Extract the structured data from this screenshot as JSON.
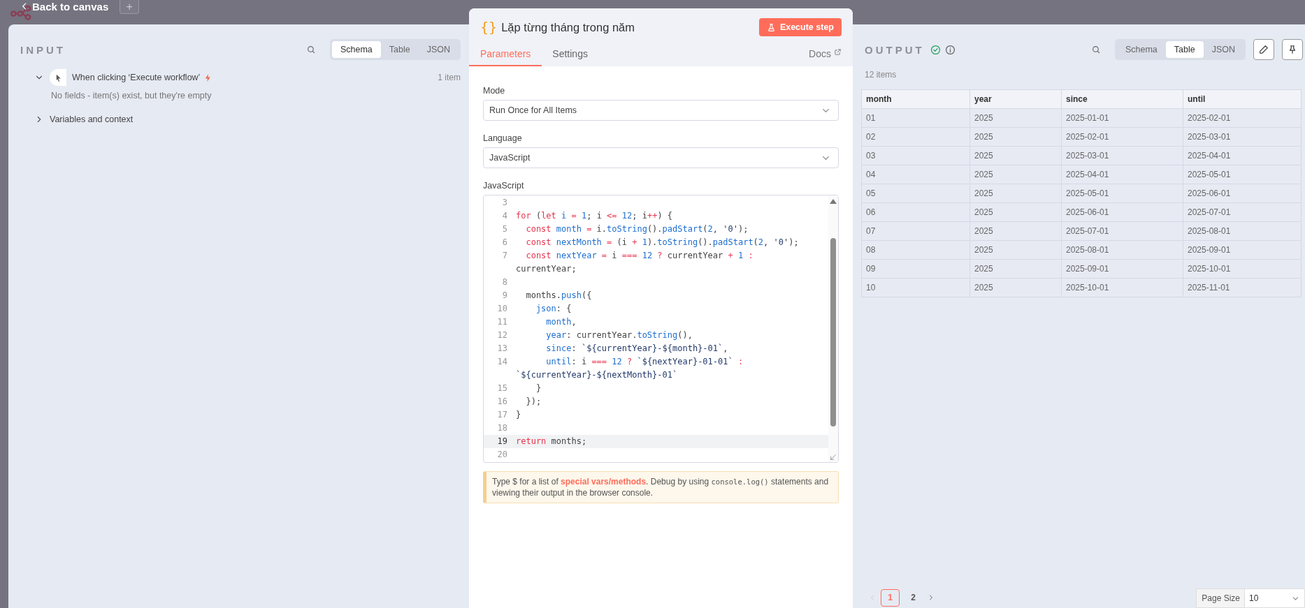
{
  "top_bar": {
    "back_label": "Back to canvas",
    "add_label": "+"
  },
  "input_panel": {
    "title": "INPUT",
    "view_tabs": [
      {
        "label": "Schema",
        "selected": true
      },
      {
        "label": "Table",
        "selected": false
      },
      {
        "label": "JSON",
        "selected": false
      }
    ],
    "tree": [
      {
        "label": "When clicking ‘Execute workflow’",
        "expanded": true,
        "kind": "trigger",
        "count": "1 item",
        "note": "No fields - item(s) exist, but they're empty"
      },
      {
        "label": "Variables and context",
        "expanded": false,
        "kind": "group"
      }
    ]
  },
  "node_panel": {
    "icon": "{}",
    "title": "Lặp từng tháng trong năm",
    "execute_button": "Execute step",
    "tabs": [
      {
        "label": "Parameters",
        "selected": true
      },
      {
        "label": "Settings",
        "selected": false
      }
    ],
    "docs_link": "Docs",
    "fields": [
      {
        "label": "Mode",
        "value": "Run Once for All Items"
      },
      {
        "label": "Language",
        "value": "JavaScript"
      }
    ],
    "code_label": "JavaScript",
    "code_lines": [
      {
        "number": "3",
        "active": false
      },
      {
        "number": "4",
        "active": false,
        "tokens": [
          {
            "kind": "kw",
            "text": "for"
          },
          {
            "kind": "p",
            "text": " ("
          },
          {
            "kind": "kw",
            "text": "let"
          },
          {
            "kind": "def",
            "text": " i"
          },
          {
            "kind": "op",
            "text": " ="
          },
          {
            "kind": "num",
            "text": " 1"
          },
          {
            "kind": "p",
            "text": "; i "
          },
          {
            "kind": "op",
            "text": "<="
          },
          {
            "kind": "num",
            "text": " 12"
          },
          {
            "kind": "p",
            "text": "; i"
          },
          {
            "kind": "op",
            "text": "++"
          },
          {
            "kind": "p",
            "text": ") {"
          }
        ]
      },
      {
        "number": "5",
        "active": false,
        "tokens": [
          {
            "kind": "kw",
            "text": "  const"
          },
          {
            "kind": "def",
            "text": " month"
          },
          {
            "kind": "op",
            "text": " ="
          },
          {
            "kind": "p",
            "text": " i."
          },
          {
            "kind": "prop",
            "text": "toString"
          },
          {
            "kind": "p",
            "text": "()."
          },
          {
            "kind": "prop",
            "text": "padStart"
          },
          {
            "kind": "p",
            "text": "("
          },
          {
            "kind": "num",
            "text": "2"
          },
          {
            "kind": "p",
            "text": ", "
          },
          {
            "kind": "str",
            "text": "'0'"
          },
          {
            "kind": "p",
            "text": ");"
          }
        ]
      },
      {
        "number": "6",
        "active": false,
        "tokens": [
          {
            "kind": "kw",
            "text": "  const"
          },
          {
            "kind": "def",
            "text": " nextMonth"
          },
          {
            "kind": "op",
            "text": " ="
          },
          {
            "kind": "p",
            "text": " (i "
          },
          {
            "kind": "op",
            "text": "+"
          },
          {
            "kind": "num",
            "text": " 1"
          },
          {
            "kind": "p",
            "text": ")."
          },
          {
            "kind": "prop",
            "text": "toString"
          },
          {
            "kind": "p",
            "text": "()."
          },
          {
            "kind": "prop",
            "text": "padStart"
          },
          {
            "kind": "p",
            "text": "("
          },
          {
            "kind": "num",
            "text": "2"
          },
          {
            "kind": "p",
            "text": ", "
          },
          {
            "kind": "str",
            "text": "'0'"
          },
          {
            "kind": "p",
            "text": ");"
          }
        ]
      },
      {
        "number": "7",
        "active": false,
        "tokens": [
          {
            "kind": "kw",
            "text": "  const"
          },
          {
            "kind": "def",
            "text": " nextYear"
          },
          {
            "kind": "op",
            "text": " ="
          },
          {
            "kind": "p",
            "text": " i "
          },
          {
            "kind": "op",
            "text": "==="
          },
          {
            "kind": "num",
            "text": " 12"
          },
          {
            "kind": "op",
            "text": " ?"
          },
          {
            "kind": "p",
            "text": " currentYear "
          },
          {
            "kind": "op",
            "text": "+"
          },
          {
            "kind": "num",
            "text": " 1"
          },
          {
            "kind": "op",
            "text": " :"
          }
        ],
        "continuation": [
          {
            "kind": "p",
            "text": "currentYear;"
          }
        ]
      },
      {
        "number": "8",
        "active": false
      },
      {
        "number": "9",
        "active": false,
        "tokens": [
          {
            "kind": "p",
            "text": "  months."
          },
          {
            "kind": "prop",
            "text": "push"
          },
          {
            "kind": "p",
            "text": "({"
          }
        ]
      },
      {
        "number": "10",
        "active": false,
        "tokens": [
          {
            "kind": "prop",
            "text": "    json"
          },
          {
            "kind": "p",
            "text": ": {"
          }
        ]
      },
      {
        "number": "11",
        "active": false,
        "tokens": [
          {
            "kind": "prop",
            "text": "      month"
          },
          {
            "kind": "p",
            "text": ","
          }
        ]
      },
      {
        "number": "12",
        "active": false,
        "tokens": [
          {
            "kind": "prop",
            "text": "      year"
          },
          {
            "kind": "p",
            "text": ": currentYear."
          },
          {
            "kind": "prop",
            "text": "toString"
          },
          {
            "kind": "p",
            "text": "(),"
          }
        ]
      },
      {
        "number": "13",
        "active": false,
        "tokens": [
          {
            "kind": "prop",
            "text": "      since"
          },
          {
            "kind": "p",
            "text": ": "
          },
          {
            "kind": "str",
            "text": "`${currentYear}-${month}-01`"
          },
          {
            "kind": "p",
            "text": ","
          }
        ]
      },
      {
        "number": "14",
        "active": false,
        "tokens": [
          {
            "kind": "prop",
            "text": "      until"
          },
          {
            "kind": "p",
            "text": ": i "
          },
          {
            "kind": "op",
            "text": "==="
          },
          {
            "kind": "num",
            "text": " 12"
          },
          {
            "kind": "op",
            "text": " ?"
          },
          {
            "kind": "str",
            "text": " `${nextYear}-01-01`"
          },
          {
            "kind": "op",
            "text": " :"
          }
        ],
        "continuation": [
          {
            "kind": "str",
            "text": "`${currentYear}-${nextMonth}-01`"
          }
        ]
      },
      {
        "number": "15",
        "active": false,
        "tokens": [
          {
            "kind": "p",
            "text": "    }"
          }
        ]
      },
      {
        "number": "16",
        "active": false,
        "tokens": [
          {
            "kind": "p",
            "text": "  });"
          }
        ]
      },
      {
        "number": "17",
        "active": false,
        "tokens": [
          {
            "kind": "p",
            "text": "}"
          }
        ]
      },
      {
        "number": "18",
        "active": false
      },
      {
        "number": "19",
        "active": true,
        "tokens": [
          {
            "kind": "kw",
            "text": "return"
          },
          {
            "kind": "p",
            "text": " months;"
          }
        ]
      },
      {
        "number": "20",
        "active": false
      }
    ],
    "hint": [
      {
        "kind": "text",
        "text": "Type $ for a list of "
      },
      {
        "kind": "link",
        "text": "special vars/methods"
      },
      {
        "kind": "text",
        "text": ". Debug by using "
      },
      {
        "kind": "code",
        "text": "console.log()"
      },
      {
        "kind": "text",
        "text": " statements and viewing their output in the browser console."
      }
    ]
  },
  "output_panel": {
    "title": "OUTPUT",
    "success": true,
    "view_tabs": [
      {
        "label": "Schema",
        "selected": false
      },
      {
        "label": "Table",
        "selected": true
      },
      {
        "label": "JSON",
        "selected": false
      }
    ],
    "item_count": "12 items",
    "table": {
      "columns": [
        "month",
        "year",
        "since",
        "until"
      ],
      "rows": [
        [
          "01",
          "2025",
          "2025-01-01",
          "2025-02-01"
        ],
        [
          "02",
          "2025",
          "2025-02-01",
          "2025-03-01"
        ],
        [
          "03",
          "2025",
          "2025-03-01",
          "2025-04-01"
        ],
        [
          "04",
          "2025",
          "2025-04-01",
          "2025-05-01"
        ],
        [
          "05",
          "2025",
          "2025-05-01",
          "2025-06-01"
        ],
        [
          "06",
          "2025",
          "2025-06-01",
          "2025-07-01"
        ],
        [
          "07",
          "2025",
          "2025-07-01",
          "2025-08-01"
        ],
        [
          "08",
          "2025",
          "2025-08-01",
          "2025-09-01"
        ],
        [
          "09",
          "2025",
          "2025-09-01",
          "2025-10-01"
        ],
        [
          "10",
          "2025",
          "2025-10-01",
          "2025-11-01"
        ]
      ]
    },
    "pages": [
      {
        "label": "1",
        "selected": true
      },
      {
        "label": "2",
        "selected": false
      }
    ],
    "page_size_label": "Page Size",
    "page_size": "10"
  }
}
